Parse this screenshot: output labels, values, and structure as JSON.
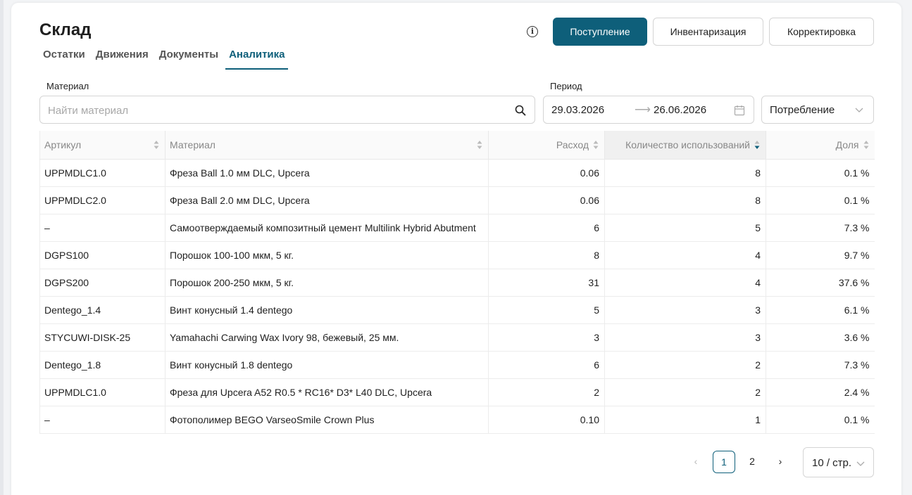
{
  "header": {
    "title": "Склад",
    "primary_button": "Поступление",
    "inventory_button": "Инвентаризация",
    "correction_button": "Корректировка"
  },
  "tabs": [
    {
      "label": "Остатки",
      "active": false
    },
    {
      "label": "Движения",
      "active": false
    },
    {
      "label": "Документы",
      "active": false
    },
    {
      "label": "Аналитика",
      "active": true
    }
  ],
  "filters": {
    "material_label": "Материал",
    "material_placeholder": "Найти материал",
    "period_label": "Период",
    "date_from": "29.03.2026",
    "date_to": "26.06.2026",
    "mode_value": "Потребление"
  },
  "table": {
    "columns": [
      "Артикул",
      "Материал",
      "Расход",
      "Количество использований",
      "Доля"
    ],
    "sorted_column": "Количество использований",
    "rows": [
      [
        "UPPMDLC1.0",
        "Фреза Ball 1.0 мм DLC, Upcera",
        "0.06",
        "8",
        "0.1 %"
      ],
      [
        "UPPMDLC2.0",
        "Фреза Ball 2.0 мм DLC, Upcera",
        "0.06",
        "8",
        "0.1 %"
      ],
      [
        "–",
        "Самоотверждаемый композитный цемент Multilink Hybrid Abutment",
        "6",
        "5",
        "7.3 %"
      ],
      [
        "DGPS100",
        "Порошок 100-100 мкм, 5 кг.",
        "8",
        "4",
        "9.7 %"
      ],
      [
        "DGPS200",
        "Порошок 200-250 мкм, 5 кг.",
        "31",
        "4",
        "37.6 %"
      ],
      [
        "Dentego_1.4",
        "Винт конусный 1.4 dentego",
        "5",
        "3",
        "6.1 %"
      ],
      [
        "STYCUWI-DISK-25",
        "Yamahachi Carwing Wax Ivory 98, бежевый, 25 мм.",
        "3",
        "3",
        "3.6 %"
      ],
      [
        "Dentego_1.8",
        "Винт конусный 1.8 dentego",
        "6",
        "2",
        "7.3 %"
      ],
      [
        "UPPMDLC1.0",
        "Фреза для Upcera A52 R0.5 * RC16* D3* L40 DLC, Upcera",
        "2",
        "2",
        "2.4 %"
      ],
      [
        "–",
        "Фотополимер BEGO VarseoSmile Crown Plus",
        "0.10",
        "1",
        "0.1 %"
      ]
    ]
  },
  "pagination": {
    "prev": "‹",
    "pages": [
      "1",
      "2"
    ],
    "current": "1",
    "next": "›",
    "page_size": "10 / стр."
  },
  "colors": {
    "accent": "#0e5f7a",
    "border": "#d4d4d4"
  },
  "icons": [
    "info-icon",
    "search-icon",
    "calendar-icon",
    "chevron-down-icon",
    "sort-icon",
    "arrow-right-icon"
  ]
}
